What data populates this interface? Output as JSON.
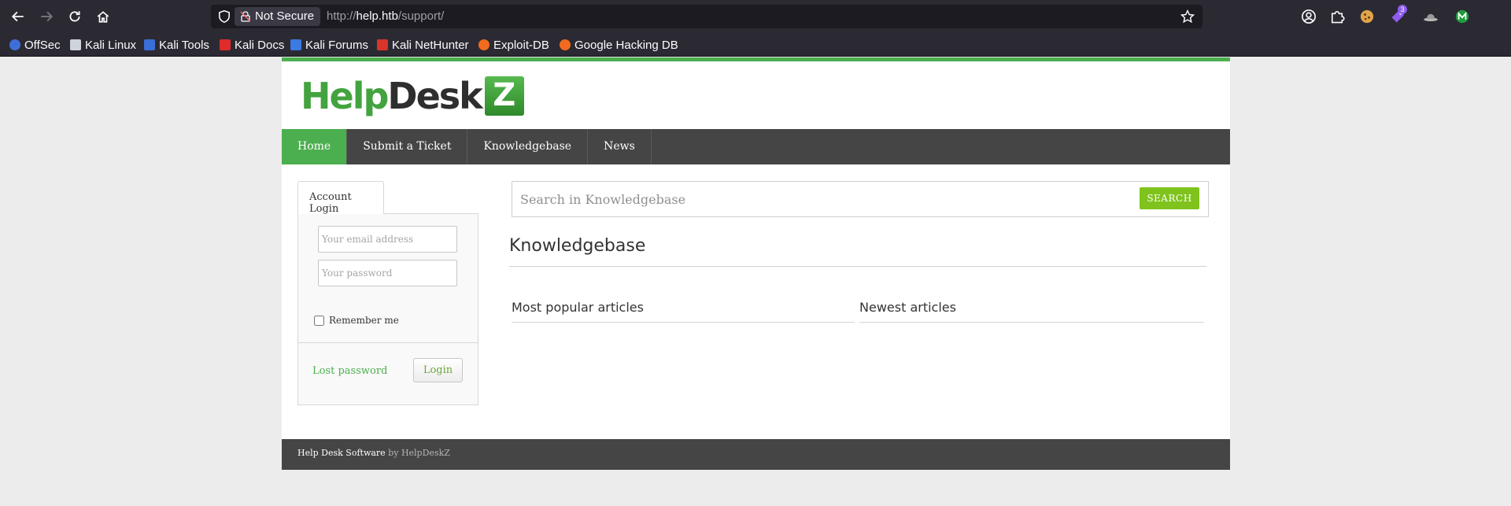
{
  "browser": {
    "not_secure": "Not Secure",
    "url_scheme": "http://",
    "url_host": "help.htb",
    "url_path": "/support/",
    "extension_badge": "3"
  },
  "bookmarks": [
    "OffSec",
    "Kali Linux",
    "Kali Tools",
    "Kali Docs",
    "Kali Forums",
    "Kali NetHunter",
    "Exploit-DB",
    "Google Hacking DB"
  ],
  "logo": {
    "help": "Help",
    "desk": "Desk",
    "z": "Z"
  },
  "menu": [
    "Home",
    "Submit a Ticket",
    "Knowledgebase",
    "News"
  ],
  "login": {
    "tab": "Account Login",
    "email_placeholder": "Your email address",
    "password_placeholder": "Your password",
    "remember": "Remember me",
    "lost_password": "Lost password",
    "button": "Login"
  },
  "search": {
    "placeholder": "Search in Knowledgebase",
    "button": "SEARCH"
  },
  "knowledgebase": {
    "title": "Knowledgebase",
    "popular": "Most popular articles",
    "newest": "Newest articles"
  },
  "footer": {
    "software": "Help Desk Software",
    "by": "by HelpDeskZ"
  },
  "colors": {
    "accent": "#4caf4f",
    "search_button": "#7fc31c",
    "menubar": "#454545"
  }
}
